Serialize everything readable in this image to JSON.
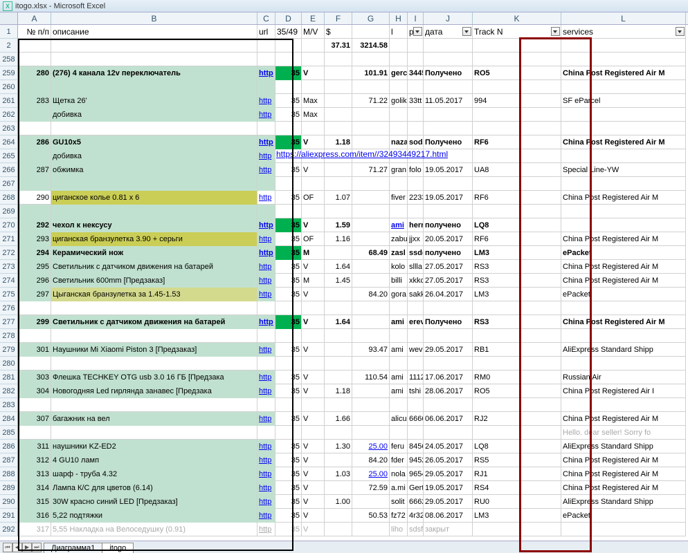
{
  "title": "itogo.xlsx - Microsoft Excel",
  "columns": [
    "A",
    "B",
    "C",
    "D",
    "E",
    "F",
    "G",
    "H",
    "I",
    "J",
    "K",
    "L"
  ],
  "headers": {
    "A": "№ п/п",
    "B": "описание",
    "C": "url",
    "D": "35/49",
    "E": "M/V",
    "F": "$",
    "G": "",
    "H": "l",
    "I": "p",
    "J": "дата",
    "K": "Track N",
    "L": "services"
  },
  "sumrow": {
    "F": "37.31",
    "G": "3214.58"
  },
  "rownums": [
    "1",
    "2",
    "258",
    "259",
    "260",
    "261",
    "262",
    "263",
    "264",
    "265",
    "266",
    "267",
    "268",
    "269",
    "270",
    "271",
    "272",
    "273",
    "274",
    "275",
    "276",
    "277",
    "278",
    "279",
    "280",
    "281",
    "282",
    "283",
    "284",
    "285",
    "286",
    "287",
    "288",
    "289",
    "290",
    "291",
    "292"
  ],
  "hlink": "https://aliexpress.com/item//32493449217.html",
  "rows": [
    {
      "cls": "greenbg bold",
      "A": "280",
      "B": "(276) 4 канала 12v переключатель",
      "C": "http",
      "D": "35",
      "Dg": true,
      "E": "V",
      "F": "",
      "G": "101.91",
      "H": "gerc",
      "I": "3445",
      "J": "Получено",
      "K": "RO5",
      "L": "China Post Registered Air M"
    },
    {
      "cls": "greenbg",
      "A": "",
      "B": "",
      "C": "",
      "D": "",
      "E": "",
      "F": "",
      "G": "",
      "H": "",
      "I": "",
      "J": "",
      "K": "",
      "L": ""
    },
    {
      "cls": "greenbg",
      "A": "283",
      "B": "Щетка 26'",
      "C": "http",
      "D": "35",
      "E": "Max",
      "F": "",
      "G": "71.22",
      "H": "golik",
      "I": "33tt",
      "J": "11.05.2017",
      "K": "994",
      "L": "SF eParcel"
    },
    {
      "cls": "greenbg",
      "A": "",
      "B": "добивка",
      "C": "http",
      "D": "35",
      "E": "Max",
      "F": "",
      "G": "",
      "H": "",
      "I": "",
      "J": "",
      "K": "",
      "L": ""
    },
    {
      "cls": "",
      "A": "",
      "B": "",
      "C": "",
      "D": "",
      "E": "",
      "F": "",
      "G": "",
      "H": "",
      "I": "",
      "J": "",
      "K": "",
      "L": ""
    },
    {
      "cls": "greenbg bold",
      "A": "286",
      "B": "GU10x5",
      "C": "http",
      "D": "35",
      "Dg": true,
      "E": "V",
      "F": "1.18",
      "G": "",
      "H": "naza",
      "I": "soda",
      "J": "Получено",
      "K": "RF6",
      "L": "China Post Registered Air M"
    },
    {
      "cls": "greenbg",
      "A": "",
      "B": "добивка",
      "C": "http",
      "D": "",
      "E": "",
      "F": "",
      "G": "",
      "H": "",
      "I": "",
      "J": "",
      "K": "",
      "L": ""
    },
    {
      "cls": "greenbg",
      "A": "287",
      "B": "обжимка",
      "C": "http",
      "D": "35",
      "E": "V",
      "F": "",
      "G": "71.27",
      "H": "gran",
      "I": "folo",
      "J": "19.05.2017",
      "K": "UA8",
      "L": "Special Line-YW"
    },
    {
      "cls": "greenbg",
      "A": "",
      "B": "",
      "C": "",
      "D": "",
      "E": "",
      "F": "",
      "G": "",
      "H": "",
      "I": "",
      "J": "",
      "K": "",
      "L": ""
    },
    {
      "cls": "olive",
      "A": "290",
      "B": "циганское колье 0.81 x 6",
      "C": "http",
      "D": "35",
      "E": "OF",
      "F": "1.07",
      "G": "",
      "H": "fiver",
      "I": "2233",
      "J": "19.05.2017",
      "K": "RF6",
      "L": "China Post Registered Air M",
      "Bcls": "olivebg"
    },
    {
      "cls": "greenbg",
      "A": "",
      "B": "",
      "C": "",
      "D": "",
      "E": "",
      "F": "",
      "G": "",
      "H": "",
      "I": "",
      "J": "",
      "K": "",
      "L": ""
    },
    {
      "cls": "greenbg bold",
      "A": "292",
      "B": "чехол к нексусу",
      "C": "http",
      "D": "35",
      "Dg": true,
      "E": "V",
      "F": "1.59",
      "G": "",
      "H": "ami",
      "Hlink": true,
      "I": "herr",
      "J": "получено",
      "K": "LQ8",
      "L": ""
    },
    {
      "cls": "greenbg",
      "A": "293",
      "B": "циганская бранзулетка 3.90 + серьги",
      "C": "http",
      "D": "35",
      "E": "OF",
      "F": "1.16",
      "G": "",
      "H": "zabu",
      "I": "jjxx",
      "J": "20.05.2017",
      "K": "RF6",
      "L": "China Post Registered Air M",
      "Bcls": "olivebg"
    },
    {
      "cls": "greenbg bold",
      "A": "294",
      "B": "Керамический нож",
      "C": "http",
      "D": "35",
      "Dg": true,
      "E": "M",
      "F": "",
      "G": "68.49",
      "H": "zasl",
      "I": "ssdc",
      "J": "получено",
      "K": "LM3",
      "L": "ePacket"
    },
    {
      "cls": "greenbg",
      "A": "295",
      "B": "Светильник с датчиком движения на батарей",
      "C": "http",
      "D": "35",
      "E": "V",
      "F": "1.64",
      "G": "",
      "H": "kolo",
      "I": "sllla",
      "J": "27.05.2017",
      "K": "RS3",
      "L": "China Post Registered Air M"
    },
    {
      "cls": "greenbg",
      "A": "296",
      "B": "Светильник 600mm  [Предзаказ]",
      "C": "http",
      "D": "35",
      "E": "M",
      "F": "1.45",
      "G": "",
      "H": "billi",
      "I": "xkkc",
      "J": "27.05.2017",
      "K": "RS3",
      "L": "China Post Registered Air M"
    },
    {
      "cls": "greenbg",
      "A": "297",
      "B": "Цыганская бранзулетка за 1.45-1.53",
      "C": "http",
      "D": "35",
      "E": "V",
      "F": "",
      "G": "84.20",
      "H": "gora",
      "I": "sakk",
      "J": "26.04.2017",
      "K": "LM3",
      "L": "ePacket",
      "Bcls": "olivelight"
    },
    {
      "cls": "",
      "A": "",
      "B": "",
      "C": "",
      "D": "",
      "E": "",
      "F": "",
      "G": "",
      "H": "",
      "I": "",
      "J": "",
      "K": "",
      "L": ""
    },
    {
      "cls": "greenbg bold",
      "A": "299",
      "B": "Светильник с датчиком движения на батарей",
      "C": "http",
      "D": "35",
      "Dg": true,
      "E": "V",
      "F": "1.64",
      "G": "",
      "H": "ami",
      "I": "erev",
      "J": "Получено",
      "K": "RS3",
      "L": "China Post Registered Air M"
    },
    {
      "cls": "",
      "A": "",
      "B": "",
      "C": "",
      "D": "",
      "E": "",
      "F": "",
      "G": "",
      "H": "",
      "I": "",
      "J": "",
      "K": "",
      "L": ""
    },
    {
      "cls": "greenbg",
      "A": "301",
      "B": "Наушники  Mi Xiaomi Piston 3  [Предзаказ]",
      "C": "http",
      "D": "35",
      "E": "V",
      "F": "",
      "G": "93.47",
      "H": "ami",
      "I": "wev",
      "J": "29.05.2017",
      "K": "RB1",
      "L": "AliExpress Standard Shipp"
    },
    {
      "cls": "",
      "A": "",
      "B": "",
      "C": "",
      "D": "",
      "E": "",
      "F": "",
      "G": "",
      "H": "",
      "I": "",
      "J": "",
      "K": "",
      "L": ""
    },
    {
      "cls": "greenbg",
      "A": "303",
      "B": "Флешка TECHKEY OTG usb 3.0 16 ГБ  [Предзака",
      "C": "http",
      "D": "35",
      "E": "V",
      "F": "",
      "G": "110.54",
      "H": "ami",
      "I": "1112",
      "J": "17.06.2017",
      "K": "RM0",
      "L": "Russian Air"
    },
    {
      "cls": "greenbg",
      "A": "304",
      "B": "Новогодняя Led гирлянда занавес  [Предзака",
      "C": "http",
      "D": "35",
      "E": "V",
      "F": "1.18",
      "G": "",
      "H": "ami",
      "I": "tshi",
      "J": "28.06.2017",
      "K": "RO5",
      "L": "China Post Registered Air I"
    },
    {
      "cls": "",
      "A": "",
      "B": "",
      "C": "",
      "D": "",
      "E": "",
      "F": "",
      "G": "",
      "H": "",
      "I": "",
      "J": "",
      "K": "",
      "L": ""
    },
    {
      "cls": "greenbg",
      "A": "307",
      "B": "багажник на вел",
      "C": "http",
      "D": "35",
      "E": "V",
      "F": "1.66",
      "G": "",
      "H": "alicu",
      "I": "6666",
      "J": "06.06.2017",
      "K": "RJ2",
      "L": "China Post Registered Air M"
    },
    {
      "cls": "",
      "A": "",
      "B": "",
      "C": "",
      "D": "",
      "E": "",
      "F": "",
      "G": "",
      "H": "",
      "I": "",
      "J": "",
      "K": "",
      "L": "Hello. dear seller! Sorry fo",
      "Lgray": true
    },
    {
      "cls": "greenbg",
      "A": "311",
      "B": "наушники KZ-ED2",
      "C": "http",
      "D": "35",
      "E": "V",
      "F": "1.30",
      "G": "25.00",
      "Glink": true,
      "H": "feru",
      "I": "8456",
      "J": "24.05.2017",
      "K": "LQ8",
      "L": "AliExpress Standard Shipp"
    },
    {
      "cls": "greenbg",
      "A": "312",
      "B": "4 GU10 ламп",
      "C": "http",
      "D": "35",
      "E": "V",
      "F": "",
      "G": "84.20",
      "H": "fder",
      "I": "9452",
      "J": "26.05.2017",
      "K": "RS5",
      "L": "China Post Registered Air M"
    },
    {
      "cls": "greenbg",
      "A": "313",
      "B": "шарф - труба 4.32",
      "C": "http",
      "D": "35",
      "E": "V",
      "F": "1.03",
      "G": "25.00",
      "Glink": true,
      "H": "nola",
      "I": "9654",
      "J": "29.05.2017",
      "K": "RJ1",
      "L": "China Post Registered Air M"
    },
    {
      "cls": "greenbg",
      "A": "314",
      "B": "Лампа К/С для цветов (6.14)",
      "C": "http",
      "D": "35",
      "E": "V",
      "F": "",
      "G": "72.59",
      "H": "a.mi",
      "I": "Gert",
      "J": "19.05.2017",
      "K": "RS4",
      "L": "China Post Registered Air M"
    },
    {
      "cls": "greenbg",
      "A": "315",
      "B": "30W красно синий LED [Предзаказ]",
      "C": "http",
      "D": "35",
      "E": "V",
      "F": "1.00",
      "G": "",
      "H": "solit",
      "I": "6662",
      "J": "29.05.2017",
      "K": "RU0",
      "L": "AliExpress Standard Shipp"
    },
    {
      "cls": "greenbg",
      "A": "316",
      "B": "5,22 подтяжки",
      "C": "http",
      "D": "35",
      "E": "V",
      "F": "",
      "G": "50.53",
      "H": "fz72",
      "I": "4r32",
      "J": "08.06.2017",
      "K": "LM3",
      "L": "ePacket"
    },
    {
      "cls": "gray",
      "A": "317",
      "B": "5,55 Накладка на Велоседушку (0.91)",
      "C": "http",
      "D": "35",
      "E": "V",
      "F": "",
      "G": "",
      "H": "liho",
      "I": "sdsf",
      "J": "закрыт",
      "K": "",
      "L": ""
    }
  ],
  "tabs": {
    "nav": [
      "⏮",
      "◀",
      "▶",
      "⏭"
    ],
    "sheets": [
      "Диаграмма1",
      "itogo"
    ],
    "active": "itogo"
  }
}
